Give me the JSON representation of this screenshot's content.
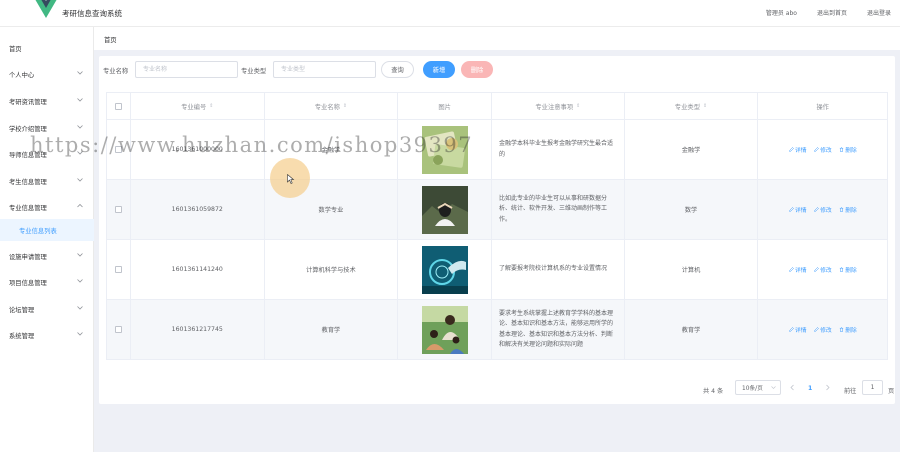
{
  "header": {
    "title": "考研信息查询系统",
    "admin": "管理员 abo",
    "exit_home": "退出到首页",
    "logout": "退出登录",
    "brand_color": "#41b883"
  },
  "sidebar": {
    "items": [
      {
        "label": "首页",
        "has_arrow": false
      },
      {
        "label": "个人中心",
        "has_arrow": true
      },
      {
        "label": "考研资讯管理",
        "has_arrow": true
      },
      {
        "label": "学校介绍管理",
        "has_arrow": true
      },
      {
        "label": "导师信息管理",
        "has_arrow": true
      },
      {
        "label": "考生信息管理",
        "has_arrow": true
      },
      {
        "label": "专业信息管理",
        "has_arrow": true,
        "expanded": true
      },
      {
        "label": "专业信息列表",
        "sub": true,
        "active": true
      },
      {
        "label": "设施申请管理",
        "has_arrow": true
      },
      {
        "label": "项目信息管理",
        "has_arrow": true
      },
      {
        "label": "论坛管理",
        "has_arrow": true
      },
      {
        "label": "系统管理",
        "has_arrow": true
      }
    ]
  },
  "breadcrumb": "首页",
  "search": {
    "name_label": "专业名称",
    "name_placeholder": "专业名称",
    "type_label": "专业类型",
    "type_placeholder": "专业类型",
    "query_btn": "查询",
    "add_btn": "新增",
    "delete_btn": "删除"
  },
  "table": {
    "headers": [
      "专业编号",
      "专业名称",
      "图片",
      "专业注意事项",
      "专业类型",
      "操作"
    ],
    "rows": [
      {
        "code": "1601361000000",
        "name": "金融学",
        "image": "money-photo",
        "note": "金融学本科毕业生报考金融学研究生最合适的",
        "type": "金融学"
      },
      {
        "code": "1601361059872",
        "name": "数学专业",
        "image": "thinking-person-photo",
        "note": "比如此专业的毕业生可以从事和研数据分析、统计、软件开发、三维动画制作等工作。",
        "type": "数学"
      },
      {
        "code": "1601361141240",
        "name": "计算机科学与技术",
        "image": "digital-hand-photo",
        "note": "了解要报考院校计算机系的专业设置情况",
        "type": "计算机"
      },
      {
        "code": "1601361217745",
        "name": "教育学",
        "image": "teacher-students-photo",
        "note": "要求考生系统掌握上述教育学学科的基本理论、基本知识和基本方法，能够运用所学的基本理论、基本知识和基本方法分析、判断和解决有关理论问题和实际问题",
        "type": "教育学"
      }
    ],
    "actions": {
      "detail": "详情",
      "edit": "修改",
      "delete": "删除"
    }
  },
  "pagination": {
    "total_text": "共 4 条",
    "page_size": "10条/页",
    "current_page": "1",
    "goto_label": "前往",
    "goto_value": "1",
    "page_suffix": "页"
  },
  "watermark": "https://www.huzhan.com/ishop39397"
}
